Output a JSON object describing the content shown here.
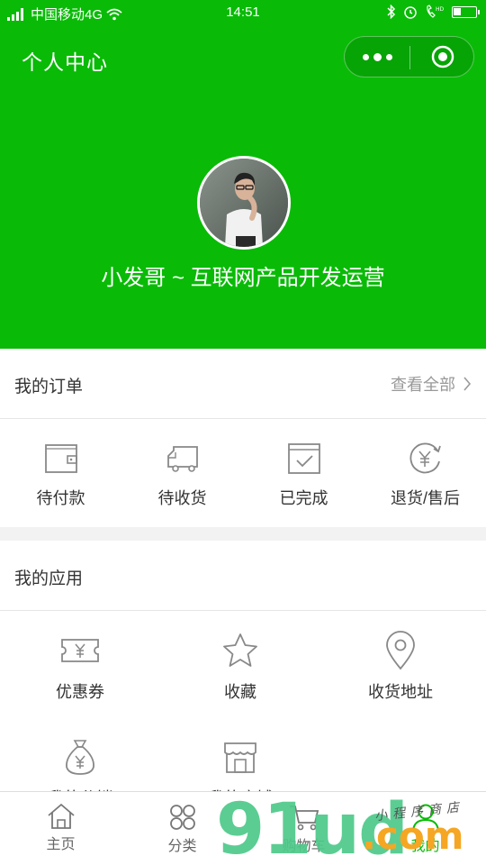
{
  "status_bar": {
    "carrier": "中国移动4G",
    "time": "14:51",
    "battery_level": 0.35
  },
  "header": {
    "title": "个人中心",
    "username": "小发哥 ~ 互联网产品开发运营",
    "theme_color": "#09bb07"
  },
  "orders": {
    "title": "我的订单",
    "view_all": "查看全部",
    "items": [
      {
        "label": "待付款",
        "icon": "wallet-icon"
      },
      {
        "label": "待收货",
        "icon": "truck-icon"
      },
      {
        "label": "已完成",
        "icon": "check-box-icon"
      },
      {
        "label": "退货/售后",
        "icon": "refund-icon"
      }
    ]
  },
  "apps": {
    "title": "我的应用",
    "items": [
      {
        "label": "优惠券",
        "icon": "coupon-icon"
      },
      {
        "label": "收藏",
        "icon": "star-icon"
      },
      {
        "label": "收货地址",
        "icon": "location-pin-icon"
      },
      {
        "label": "我的分销",
        "icon": "money-bag-icon"
      },
      {
        "label": "我的店铺",
        "icon": "shop-icon"
      }
    ]
  },
  "tabbar": {
    "items": [
      {
        "label": "主页",
        "icon": "home-icon"
      },
      {
        "label": "分类",
        "icon": "category-icon"
      },
      {
        "label": "购物车",
        "icon": "cart-icon"
      },
      {
        "label": "我的",
        "icon": "user-icon",
        "active": true
      }
    ]
  },
  "watermark": {
    "brand": "91ud",
    "domain": ".com",
    "tagline": "小程序商店"
  }
}
